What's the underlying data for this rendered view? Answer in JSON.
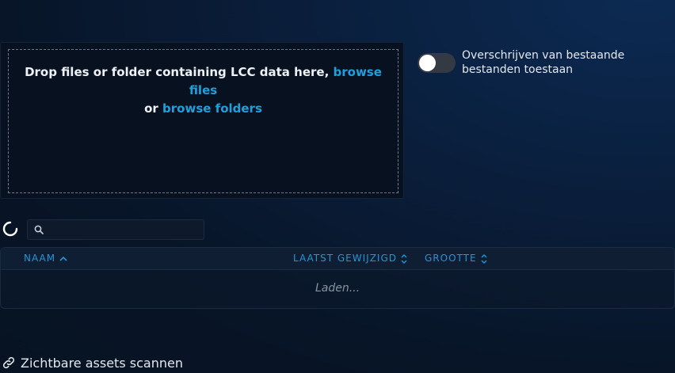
{
  "dropzone": {
    "text_before": "Drop files or folder containing LCC data here,",
    "browse_files": "browse files",
    "or_text": "or",
    "browse_folders": "browse folders"
  },
  "overwrite_toggle": {
    "label": "Overschrijven van bestaande bestanden toestaan",
    "checked": false
  },
  "search": {
    "placeholder": "",
    "value": ""
  },
  "table": {
    "columns": [
      {
        "label": "NAAM",
        "sort": "ascending"
      },
      {
        "label": "LAATST GEWIJZIGD",
        "sort": "unsorted"
      },
      {
        "label": "GROOTTE",
        "sort": "unsorted"
      }
    ],
    "status": "Laden..."
  },
  "footer": {
    "scan_label": "Zichtbare assets scannen"
  },
  "colors": {
    "accent": "#1fa0dc",
    "background": "#081528"
  },
  "icons": [
    "refresh-icon",
    "search-icon",
    "sort-asc-icon",
    "sort-icon",
    "link-icon"
  ]
}
